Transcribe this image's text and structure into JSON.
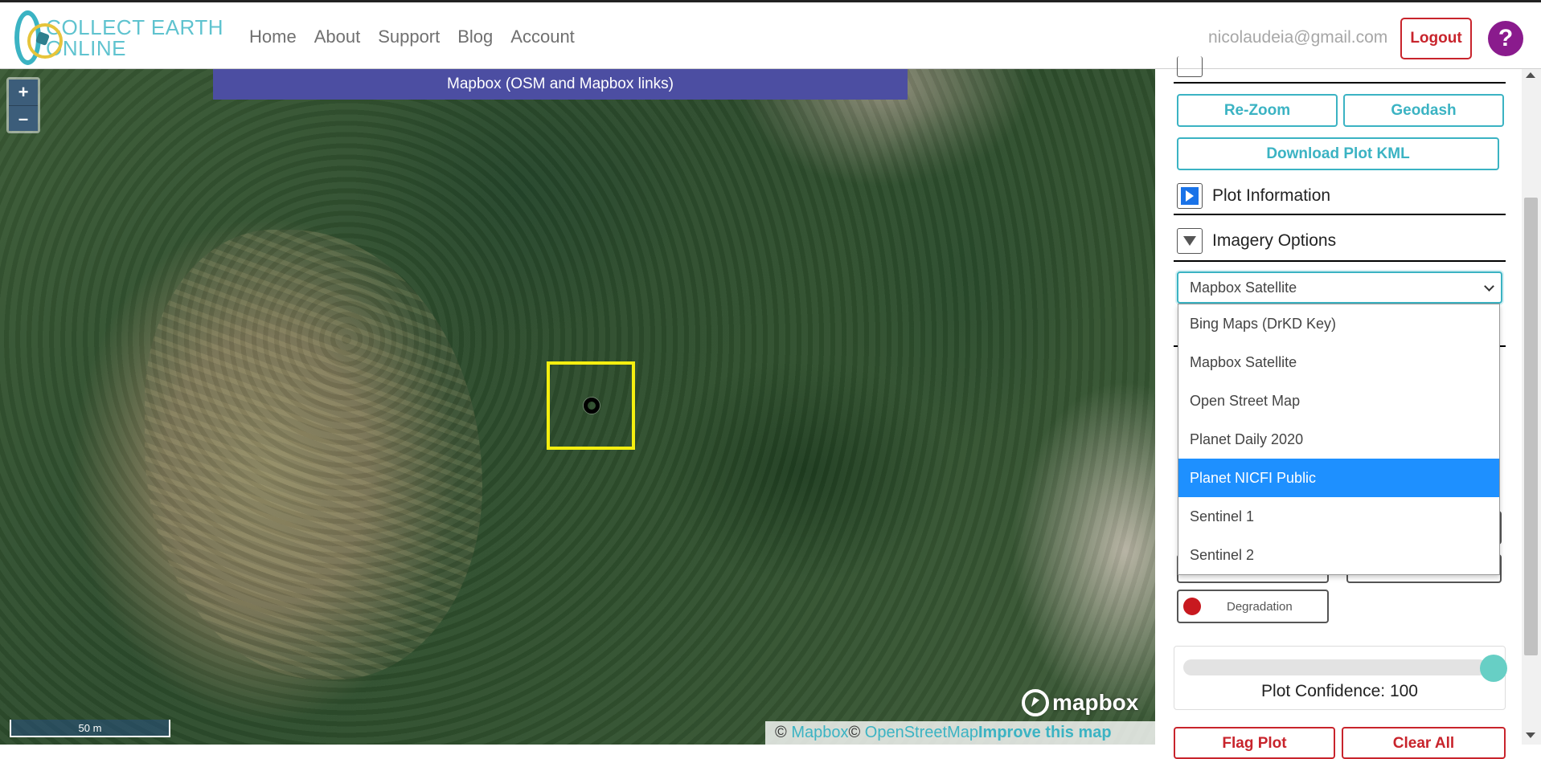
{
  "brand": {
    "line1": "COLLECT EARTH",
    "line2": "ONLINE"
  },
  "nav": {
    "links": [
      "Home",
      "About",
      "Support",
      "Blog",
      "Account"
    ]
  },
  "user": {
    "email": "nicolaudeia@gmail.com",
    "logout_label": "Logout",
    "help_label": "?"
  },
  "map": {
    "imagery_banner": "Mapbox (OSM and Mapbox links)",
    "zoom_in": "+",
    "zoom_out": "–",
    "scale_label": "50 m",
    "logo_text": "mapbox",
    "attribution": {
      "copyright": "©",
      "mapbox": "Mapbox",
      "osm": "OpenStreetMap",
      "improve": "Improve this map"
    }
  },
  "panel": {
    "rezoom_label": "Re-Zoom",
    "geodash_label": "Geodash",
    "download_kml_label": "Download Plot KML",
    "plot_info_title": "Plot Information",
    "imagery_options_title": "Imagery Options",
    "imagery_select": {
      "selected": "Mapbox Satellite",
      "options": [
        "Bing Maps (DrKD Key)",
        "Mapbox Satellite",
        "Open Street Map",
        "Planet Daily 2020",
        "Planet NICFI Public",
        "Sentinel 1",
        "Sentinel 2"
      ],
      "highlighted": "Planet NICFI Public"
    },
    "degradation_label": "Degradation",
    "degradation_color": "#c8191f",
    "confidence_label": "Plot Confidence: 100",
    "confidence_value": 100,
    "flag_label": "Flag Plot",
    "clear_label": "Clear All"
  },
  "colors": {
    "accent": "#3bb3c3",
    "danger": "#c8242c",
    "help": "#8a1b8d",
    "banner": "#4c4ea2",
    "plot_outline": "#f4ee10"
  }
}
